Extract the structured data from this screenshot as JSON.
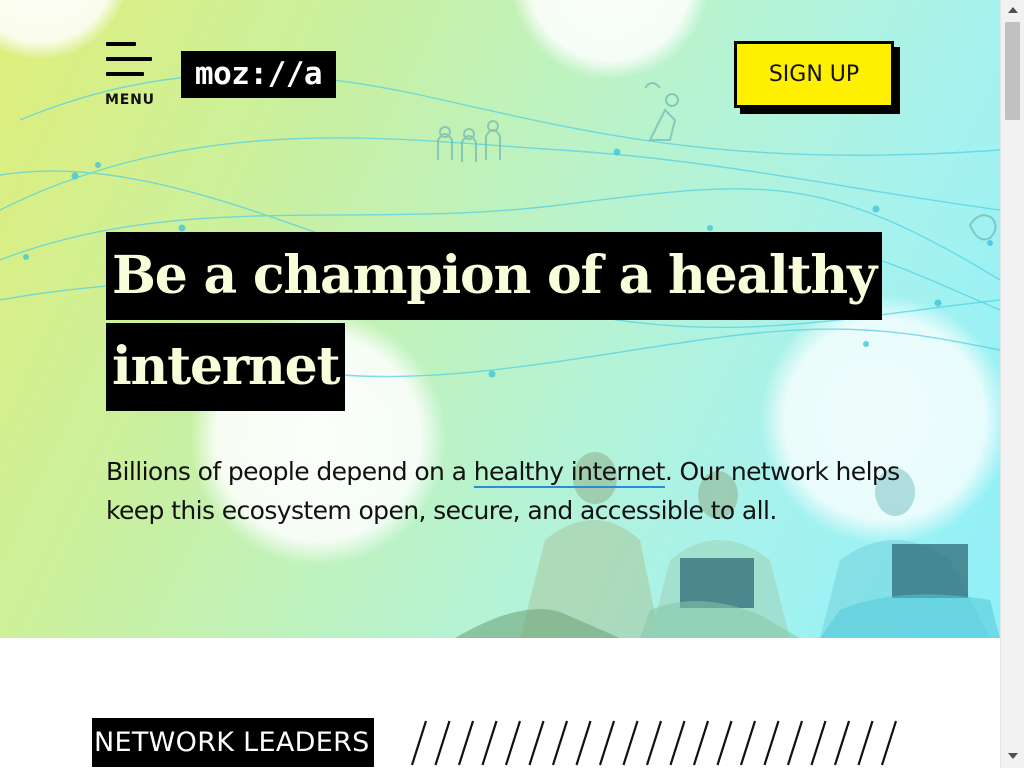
{
  "nav": {
    "menu_label": "MENU",
    "logo_text": "moz://a",
    "signup_label": "SIGN UP"
  },
  "hero": {
    "headline_line1": "Be a champion of a healthy",
    "headline_line2": "internet",
    "intro_before": "Billions of people depend on a ",
    "intro_link": "healthy internet",
    "intro_after": ". Our network helps keep this ecosystem open, secure, and accessible to all."
  },
  "section": {
    "label": "NETWORK LEADERS"
  },
  "colors": {
    "signup_bg": "#fff000",
    "headline_bg": "#000000",
    "link_underline": "#2a8bd8"
  },
  "icons": [
    "hamburger-menu-icon",
    "scroll-up-arrow-icon",
    "scroll-down-arrow-icon"
  ]
}
